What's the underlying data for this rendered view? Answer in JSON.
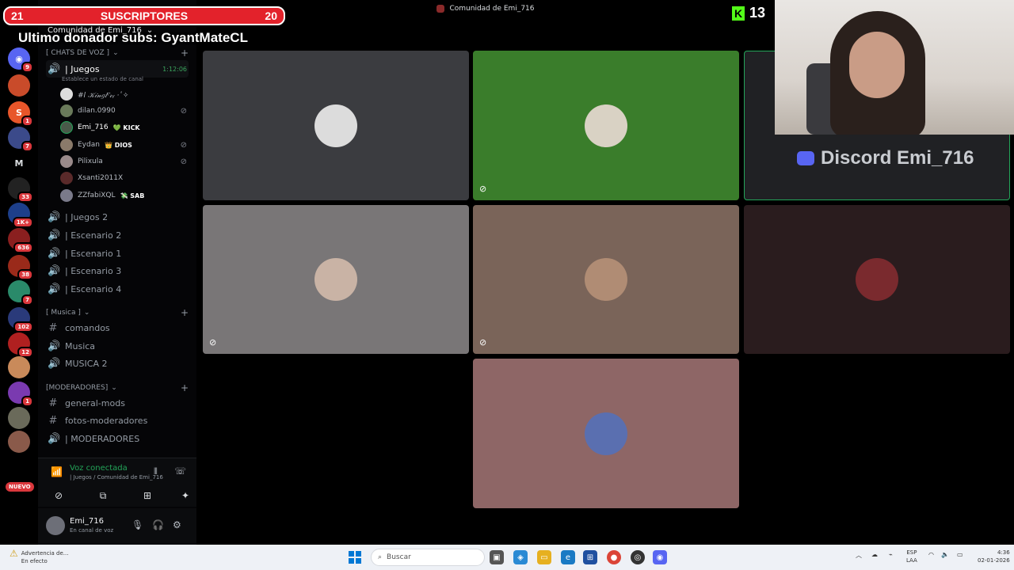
{
  "overlay": {
    "subs_left": "21",
    "subs_label": "SUSCRIPTORES",
    "subs_right": "20",
    "donor_text": "Ultimo donador subs: GyantMateCL"
  },
  "window": {
    "title": "Comunidad de Emi_716"
  },
  "kick": {
    "count": "13"
  },
  "server": {
    "name": "Comunidad de Emi_716"
  },
  "rail": {
    "badges": [
      "9",
      "1",
      "7",
      "M",
      "33",
      "1K+",
      "636",
      "38",
      "7",
      "102",
      "12",
      "1"
    ],
    "new_label": "NUEVO"
  },
  "sidebar": {
    "voice_category": "[ CHATS DE VOZ ]",
    "active_channel": {
      "name": "| Juegos",
      "time": "1:12:06",
      "status": "Establece un estado de canal"
    },
    "members": [
      {
        "name": "#l 𝒦𝒾𝓃𝑔𝐹𝓇ᵧ ·ﾟ✧",
        "tag": "",
        "muted": true
      },
      {
        "name": "dilan.0990",
        "tag": "",
        "muted": true
      },
      {
        "name": "Emi_716",
        "tag": "💚 KICK",
        "muted": false
      },
      {
        "name": "Eydan",
        "tag": "👑 DIOS",
        "muted": true
      },
      {
        "name": "Pilixula",
        "tag": "",
        "muted": true
      },
      {
        "name": "Xsanti2011X",
        "tag": "",
        "muted": false
      },
      {
        "name": "ZZfabiXQL",
        "tag": "💸 SAB",
        "muted": false
      }
    ],
    "voice_channels": [
      "| Juegos 2",
      "| Escenario 2",
      "| Escenario 1",
      "| Escenario 3",
      "| Escenario 4"
    ],
    "music_category": "[ Musica ]",
    "music_channels": [
      "comandos",
      "Musica",
      "MUSICA 2"
    ],
    "mod_category": "[MODERADORES]",
    "mod_channels": [
      "general-mods",
      "fotos-moderadores",
      "| MODERADORES"
    ]
  },
  "voice_panel": {
    "title": "Voz conectada",
    "sub": "| Juegos / Comunidad de Emi_716"
  },
  "user_panel": {
    "name": "Emi_716",
    "status": "En canal de voz"
  },
  "stream": {
    "watermark": "Discord Emi_716"
  },
  "tiles": [
    {
      "bg": "#3b3c40",
      "face": "#dcdcdc",
      "muted": false
    },
    {
      "bg": "#3a7d2b",
      "face": "#d9d2c4",
      "muted": true
    },
    {
      "bg": "#202124",
      "face": "",
      "muted": false
    },
    {
      "bg": "#797677",
      "face": "#c9b3a5",
      "muted": true
    },
    {
      "bg": "#7a6459",
      "face": "#b08c74",
      "muted": true
    },
    {
      "bg": "#2a1c1e",
      "face": "#7a2a2e",
      "muted": false
    },
    {
      "bg": "#8e6666",
      "face": "#5a6fb0",
      "muted": false
    }
  ],
  "taskbar": {
    "warning_title": "Advertencia de...",
    "warning_sub": "En efecto",
    "search_placeholder": "Buscar",
    "lang": "ESP",
    "lang_sub": "LAA",
    "time": "4:36",
    "date": "02-01-2026"
  },
  "colors": {
    "accent_green": "#23a559",
    "subs_red": "#e3222b",
    "kick_green": "#53fc18"
  }
}
